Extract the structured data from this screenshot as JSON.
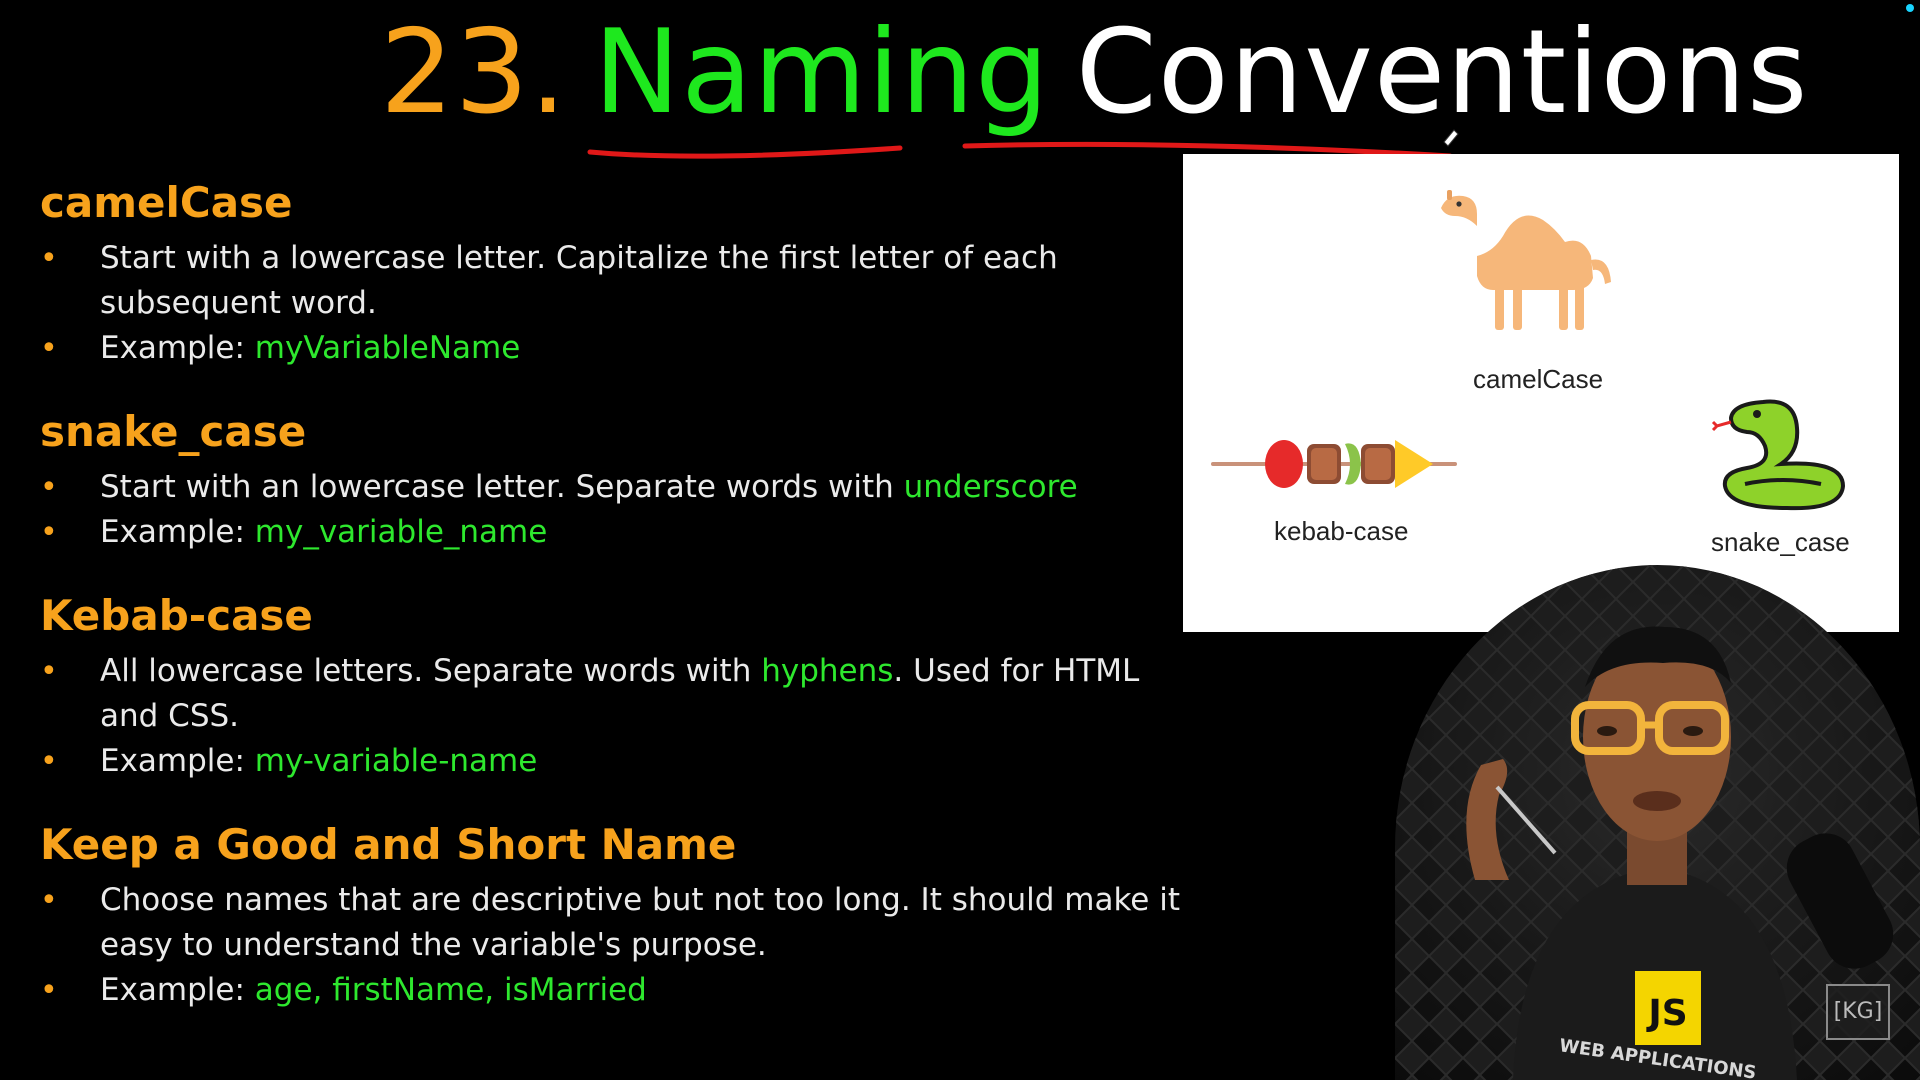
{
  "title": {
    "number": "23.",
    "word1": "Naming",
    "word2": "Conventions"
  },
  "sections": [
    {
      "heading": "camelCase",
      "bullets": [
        {
          "text": "Start with a lowercase letter. Capitalize the first letter of each subsequent word."
        },
        {
          "prefix": "Example: ",
          "highlight": "myVariableName"
        }
      ]
    },
    {
      "heading": "snake_case",
      "bullets": [
        {
          "text": "Start with an lowercase letter. Separate words with ",
          "highlight": "underscore"
        },
        {
          "prefix": "Example: ",
          "highlight": "my_variable_name"
        }
      ]
    },
    {
      "heading": "Kebab-case",
      "bullets": [
        {
          "text": "All lowercase letters. Separate words with ",
          "highlight": "hyphens",
          "suffix": ". Used for HTML and CSS."
        },
        {
          "prefix": "Example: ",
          "highlight": "my-variable-name"
        }
      ]
    },
    {
      "heading": "Keep a Good and Short Name",
      "bullets": [
        {
          "text": "Choose names that are descriptive but not too long. It should make it easy to understand the variable's purpose."
        },
        {
          "prefix": "Example: ",
          "highlight": "age, firstName, isMarried"
        }
      ]
    }
  ],
  "panel": {
    "camel_label": "camelCase",
    "kebab_label": "kebab-case",
    "snake_label": "snake_case"
  },
  "shirt_text": {
    "badge": "JS",
    "line": "WEB APPLICATIONS"
  },
  "logo": "[KG]",
  "colors": {
    "orange": "#f7a21c",
    "green": "#2ee82e",
    "title_green": "#1ee81e",
    "underline_red": "#e01818"
  }
}
